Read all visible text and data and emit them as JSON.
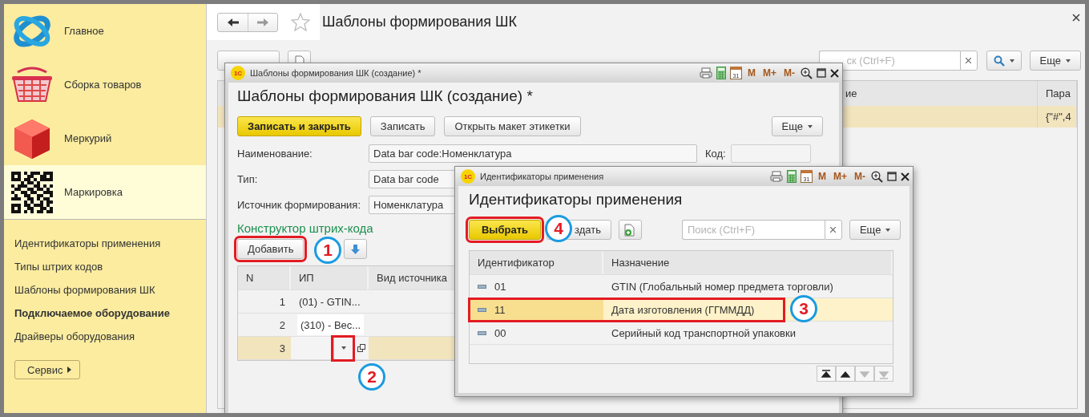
{
  "sidebar": {
    "sections": [
      {
        "label": "Главное",
        "selected": false
      },
      {
        "label": "Сборка товаров",
        "selected": false
      },
      {
        "label": "Меркурий",
        "selected": false
      },
      {
        "label": "Маркировка",
        "selected": true
      }
    ],
    "links": [
      {
        "label": "Идентификаторы применения",
        "important": false
      },
      {
        "label": "Типы штрих кодов",
        "important": false
      },
      {
        "label": "Шаблоны формирования ШК",
        "important": false
      },
      {
        "label": "Подключаемое оборудование",
        "important": true
      },
      {
        "label": "Драйверы оборудования",
        "important": false
      }
    ],
    "service_button": "Сервис"
  },
  "page": {
    "title": "Шаблоны формирования ШК",
    "search": {
      "placeholder": "ск (Ctrl+F)"
    },
    "more_button": "Еще",
    "list": {
      "columns": [
        "ие",
        "Пара"
      ],
      "rows": [
        {
          "cells": [
            "",
            "{\"#\",4"
          ],
          "selected": true
        }
      ]
    }
  },
  "template_window": {
    "logo": "1С",
    "title": "Шаблоны формирования ШК (создание) *",
    "tools": [
      {
        "kind": "print"
      },
      {
        "kind": "calculator"
      },
      {
        "kind": "calendar",
        "label": "31"
      },
      {
        "kind": "text",
        "label": "M"
      },
      {
        "kind": "text",
        "label": "M+"
      },
      {
        "kind": "text",
        "label": "M-"
      },
      {
        "kind": "zoom"
      },
      {
        "kind": "maximize"
      },
      {
        "kind": "close"
      }
    ],
    "heading": "Шаблоны формирования ШК (создание) *",
    "buttons": [
      {
        "label": "Записать и закрыть",
        "kind": "primary"
      },
      {
        "label": "Записать",
        "kind": "normal"
      },
      {
        "label": "Открыть макет этикетки",
        "kind": "normal"
      }
    ],
    "more_button": "Еще",
    "fields": [
      {
        "label": "Наименование:",
        "value": "Data bar code:Номенклатура"
      },
      {
        "label": "Тип:",
        "value": "Data bar code"
      },
      {
        "label": "Источник формирования:",
        "value": "Номенклатура"
      }
    ],
    "code_label": "Код:",
    "section_title": "Конструктор штрих-кода",
    "add_button": {
      "label": "Добавить",
      "annotated": true
    },
    "table": {
      "columns": [
        "N",
        "ИП",
        "Вид источника"
      ],
      "rows": [
        {
          "n": "1",
          "ip": "(01) - GTIN...",
          "kind": "text",
          "selected": false
        },
        {
          "n": "2",
          "ip": "(310) - Вес...",
          "kind": "boxed",
          "selected": false
        },
        {
          "n": "3",
          "kind": "editor",
          "selected": true,
          "annotated": true
        }
      ]
    }
  },
  "identifiers_window": {
    "logo": "1С",
    "title": "Идентификаторы применения",
    "tools": [
      {
        "kind": "print"
      },
      {
        "kind": "calculator"
      },
      {
        "kind": "calendar",
        "label": "31"
      },
      {
        "kind": "text",
        "label": "M"
      },
      {
        "kind": "text",
        "label": "M+"
      },
      {
        "kind": "text",
        "label": "M-"
      },
      {
        "kind": "zoom"
      },
      {
        "kind": "maximize"
      },
      {
        "kind": "close"
      }
    ],
    "heading": "Идентификаторы применения",
    "select_button": {
      "label": "Выбрать",
      "annotated": true
    },
    "create_button": "здать",
    "search": {
      "placeholder": "Поиск (Ctrl+F)"
    },
    "more_button": "Еще",
    "table": {
      "columns": [
        "Идентификатор",
        "Назначение"
      ],
      "rows": [
        {
          "id": "01",
          "purpose": "GTIN (Глобальный номер предмета торговли)",
          "selected": false,
          "annotated": false
        },
        {
          "id": "11",
          "purpose": "Дата изготовления (ГГММДД)",
          "selected": true,
          "annotated": true
        },
        {
          "id": "00",
          "purpose": "Серийный код транспортной упаковки",
          "selected": false,
          "annotated": false
        }
      ]
    }
  },
  "callouts": [
    "1",
    "2",
    "3",
    "4"
  ]
}
